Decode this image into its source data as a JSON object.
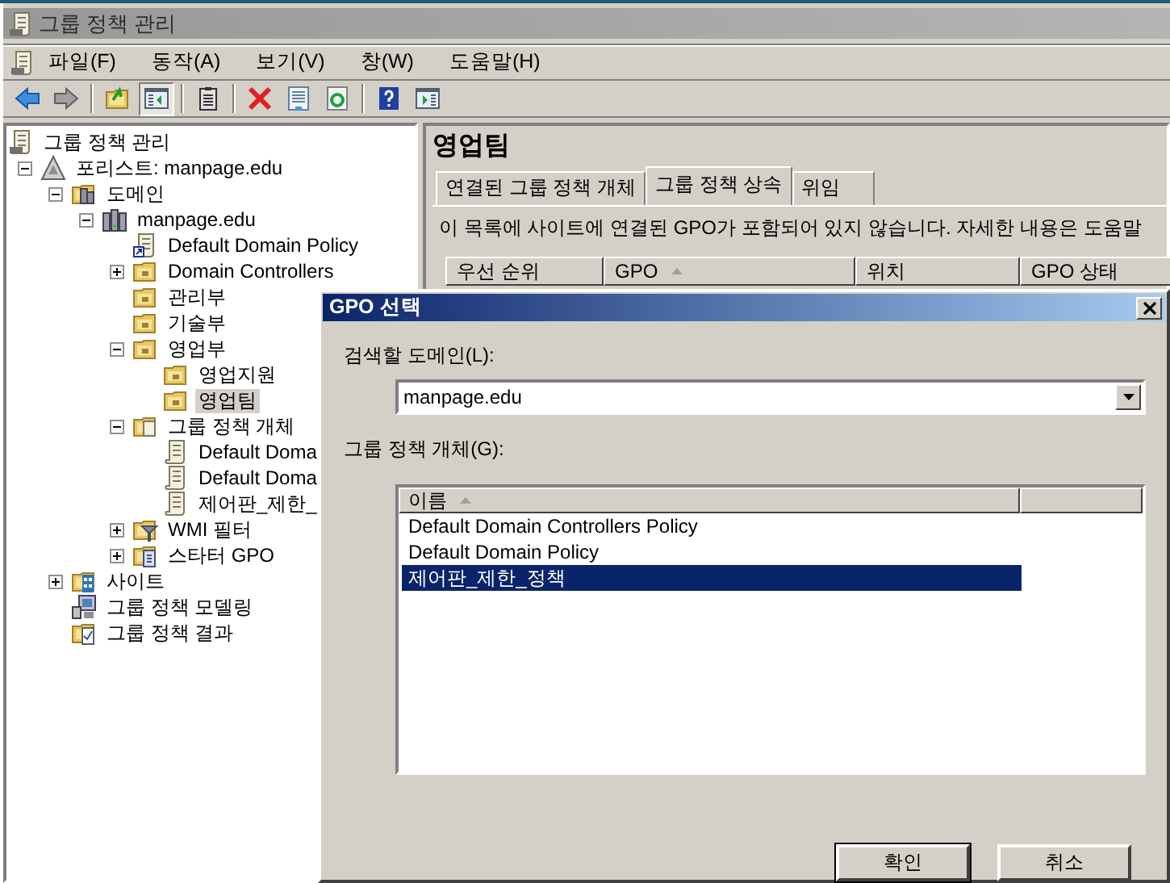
{
  "window": {
    "title": "그룹 정책 관리"
  },
  "menu": [
    {
      "label": "파일(F)"
    },
    {
      "label": "동작(A)"
    },
    {
      "label": "보기(V)"
    },
    {
      "label": "창(W)"
    },
    {
      "label": "도움말(H)"
    }
  ],
  "toolbar": [
    {
      "kind": "back",
      "pressed": false
    },
    {
      "kind": "forward",
      "pressed": false
    },
    {
      "kind": "separator"
    },
    {
      "kind": "up",
      "pressed": false
    },
    {
      "kind": "tree-pane",
      "pressed": true
    },
    {
      "kind": "separator"
    },
    {
      "kind": "export",
      "pressed": false
    },
    {
      "kind": "separator"
    },
    {
      "kind": "delete",
      "pressed": false
    },
    {
      "kind": "properties",
      "pressed": false
    },
    {
      "kind": "refresh",
      "pressed": false
    },
    {
      "kind": "separator"
    },
    {
      "kind": "help",
      "pressed": false
    },
    {
      "kind": "action-pane",
      "pressed": false
    }
  ],
  "tree": [
    {
      "label": "그룹 정책 관리",
      "kind": "console",
      "selected": false,
      "children": [
        {
          "label": "포리스트: manpage.edu",
          "kind": "forest",
          "selected": false,
          "expanded": true,
          "children": [
            {
              "label": "도메인",
              "kind": "domains",
              "selected": false,
              "expanded": true,
              "children": [
                {
                  "label": "manpage.edu",
                  "kind": "domain",
                  "selected": false,
                  "expanded": true,
                  "children": [
                    {
                      "label": "Default Domain Policy",
                      "kind": "gpo-link",
                      "selected": false
                    },
                    {
                      "label": "Domain Controllers",
                      "kind": "ou",
                      "selected": false,
                      "expanded": false
                    },
                    {
                      "label": "관리부",
                      "kind": "ou",
                      "selected": false
                    },
                    {
                      "label": "기술부",
                      "kind": "ou",
                      "selected": false
                    },
                    {
                      "label": "영업부",
                      "kind": "ou",
                      "selected": false,
                      "expanded": true,
                      "children": [
                        {
                          "label": "영업지원",
                          "kind": "ou",
                          "selected": false
                        },
                        {
                          "label": "영업팀",
                          "kind": "ou",
                          "selected": true
                        }
                      ]
                    },
                    {
                      "label": "그룹 정책 개체",
                      "kind": "gpo-folder",
                      "selected": false,
                      "expanded": true,
                      "children": [
                        {
                          "label": "Default Doma",
                          "kind": "gpo",
                          "selected": false
                        },
                        {
                          "label": "Default Doma",
                          "kind": "gpo",
                          "selected": false
                        },
                        {
                          "label": "제어판_제한_",
                          "kind": "gpo",
                          "selected": false
                        }
                      ]
                    },
                    {
                      "label": "WMI 필터",
                      "kind": "wmi",
                      "selected": false,
                      "expanded": false
                    },
                    {
                      "label": "스타터 GPO",
                      "kind": "starter",
                      "selected": false,
                      "expanded": false
                    }
                  ]
                }
              ]
            },
            {
              "label": "사이트",
              "kind": "sites",
              "selected": false,
              "expanded": false
            },
            {
              "label": "그룹 정책 모델링",
              "kind": "modeling",
              "selected": false
            },
            {
              "label": "그룹 정책 결과",
              "kind": "results",
              "selected": false
            }
          ]
        }
      ]
    }
  ],
  "detail": {
    "title": "영업팀",
    "tabs": [
      {
        "label": "연결된 그룹 정책 개체",
        "selected": false
      },
      {
        "label": "그룹 정책 상속",
        "selected": true
      },
      {
        "label": "위임",
        "selected": false
      }
    ],
    "message": "이 목록에 사이트에 연결된 GPO가 포함되어 있지 않습니다. 자세한 내용은 도움말",
    "columns": [
      {
        "label": "우선 순위",
        "sorted": false
      },
      {
        "label": "GPO",
        "sorted": true
      },
      {
        "label": "위치",
        "sorted": false
      },
      {
        "label": "GPO 상태",
        "sorted": false
      }
    ]
  },
  "dialog": {
    "title": "GPO 선택",
    "domain_label": "검색할 도메인(L):",
    "domain_value": "manpage.edu",
    "list_label": "그룹 정책 개체(G):",
    "columns": [
      {
        "label": "이름",
        "sorted": true
      }
    ],
    "rows": [
      {
        "name": "Default Domain Controllers Policy",
        "selected": false
      },
      {
        "name": "Default Domain Policy",
        "selected": false
      },
      {
        "name": "제어판_제한_정책",
        "selected": true
      }
    ],
    "buttons": [
      {
        "label": "확인",
        "default": true
      },
      {
        "label": "취소",
        "default": false
      }
    ]
  }
}
